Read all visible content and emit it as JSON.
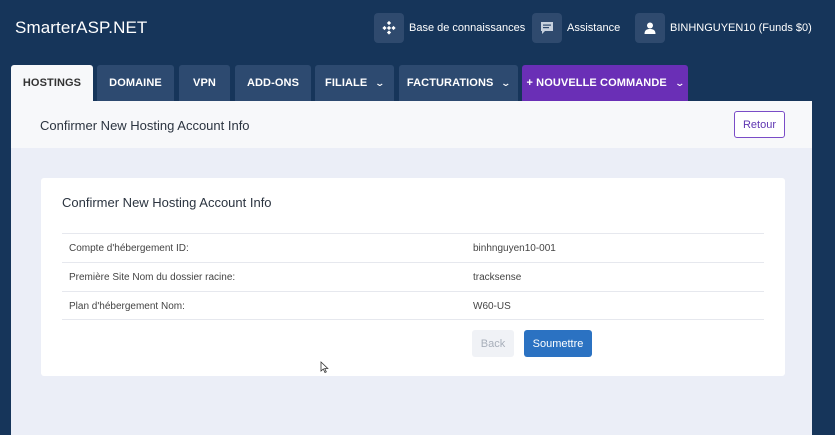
{
  "app": {
    "brand": "SmarterASP.NET"
  },
  "topnav": {
    "knowledge_base": "Base de connaissances",
    "support": "Assistance",
    "account": "BINHNGUYEN10 (Funds $0)"
  },
  "tabs": [
    {
      "label": "HOSTINGS",
      "active": true
    },
    {
      "label": "DOMAINE"
    },
    {
      "label": "VPN"
    },
    {
      "label": "ADD-ONS"
    },
    {
      "label": "FILIALE",
      "dropdown": true
    },
    {
      "label": "FACTURATIONS",
      "dropdown": true
    },
    {
      "label": "+ NOUVELLE COMMANDE",
      "dropdown": true
    }
  ],
  "page": {
    "title": "Confirmer New Hosting Account Info",
    "back_label": "Retour"
  },
  "card": {
    "title": "Confirmer New Hosting Account Info",
    "rows": [
      {
        "label": "Compte d'hébergement ID:",
        "value": "binhnguyen10-001"
      },
      {
        "label": "Première Site Nom du dossier racine:",
        "value": "tracksense"
      },
      {
        "label": "Plan d'hébergement Nom:",
        "value": "W60-US"
      }
    ],
    "back_button": "Back",
    "submit_button": "Soumettre"
  },
  "colors": {
    "background": "#16355a",
    "tab": "#2d4a70",
    "new_order_tab": "#6a2fb6",
    "primary": "#2b72c2"
  },
  "icons": {
    "knowledge_base": "diamond-dots-icon",
    "support": "chat-icon",
    "account": "user-icon",
    "dropdown": "chevron-down-icon",
    "cursor": "mouse-pointer-icon"
  }
}
